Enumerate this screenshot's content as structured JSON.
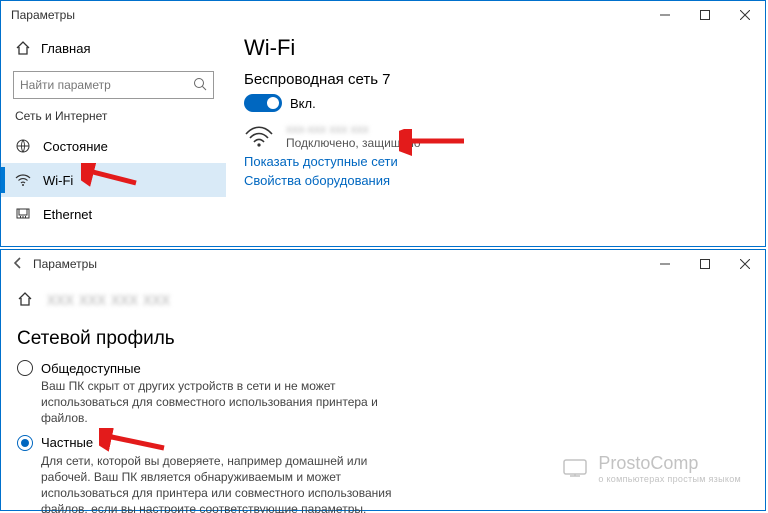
{
  "win1": {
    "title": "Параметры",
    "sidebar": {
      "home": "Главная",
      "search_placeholder": "Найти параметр",
      "section": "Сеть и Интернет",
      "items": [
        {
          "label": "Состояние"
        },
        {
          "label": "Wi-Fi"
        },
        {
          "label": "Ethernet"
        }
      ]
    },
    "main": {
      "heading": "Wi-Fi",
      "subheading": "Беспроводная сеть 7",
      "toggle_label": "Вкл.",
      "network_name_blurred": "xxx-xxx xxx xxx",
      "network_status": "Подключено, защищено",
      "link_show": "Показать доступные сети",
      "link_props": "Свойства оборудования"
    }
  },
  "win2": {
    "title": "Параметры",
    "network_name_blurred": "xxx  xxx  xxx  xxx",
    "profile_heading": "Сетевой профиль",
    "public": {
      "label": "Общедоступные",
      "desc": "Ваш ПК скрыт от других устройств в сети и не может использоваться для совместного использования принтера и файлов."
    },
    "private": {
      "label": "Частные",
      "desc": "Для сети, которой вы доверяете, например домашней или рабочей. Ваш ПК является обнаруживаемым и может использоваться для принтера или совместного использования файлов, если вы настроите соответствующие параметры."
    }
  },
  "watermark": {
    "brand": "ProstoComp",
    "tagline": "о компьютерах простым языком"
  }
}
